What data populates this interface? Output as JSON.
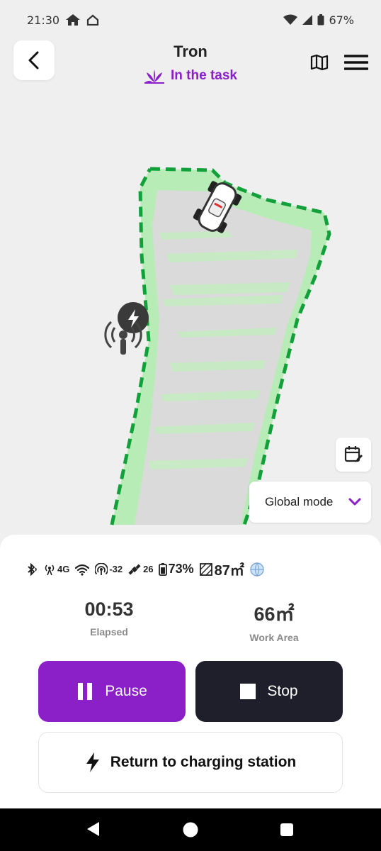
{
  "status_bar": {
    "time": "21:30",
    "battery": "67%"
  },
  "header": {
    "title": "Tron",
    "status": "In the task"
  },
  "map": {
    "mode_label": "Global mode"
  },
  "indicators": {
    "network": "4G",
    "rssi": "-32",
    "satellites": "26",
    "battery": "73%",
    "area": "87㎡"
  },
  "stats": [
    {
      "value": "00:53",
      "label": "Elapsed"
    },
    {
      "value": "66㎡",
      "label": "Work Area"
    }
  ],
  "actions": {
    "pause": "Pause",
    "stop": "Stop",
    "return": "Return to charging station"
  },
  "colors": {
    "accent": "#8b1fc8",
    "dark": "#1f1f2b",
    "lawn": "#b8ecb6",
    "border": "#12a03a"
  }
}
